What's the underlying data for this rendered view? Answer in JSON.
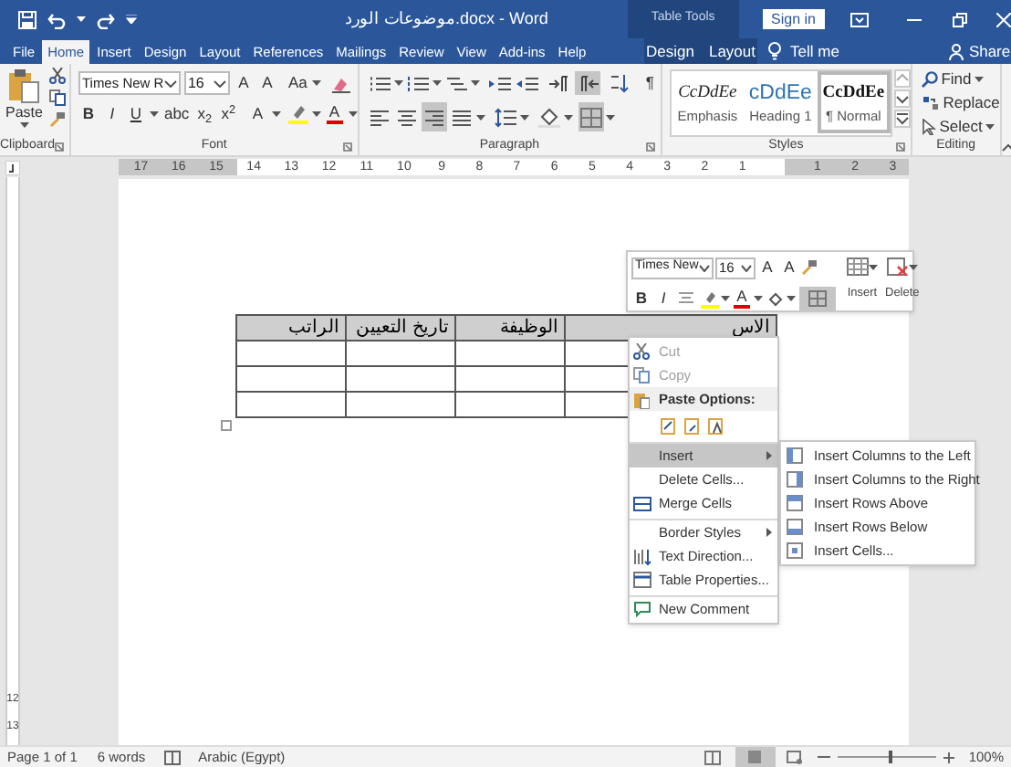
{
  "window": {
    "title": "موضوعات الورد.docx - Word"
  },
  "title_bar": {
    "contextual_label": "Table Tools",
    "sign_in": "Sign in"
  },
  "tabs": [
    {
      "label": "File",
      "selected": false
    },
    {
      "label": "Home",
      "selected": true
    },
    {
      "label": "Insert",
      "selected": false
    },
    {
      "label": "Design",
      "selected": false
    },
    {
      "label": "Layout",
      "selected": false
    },
    {
      "label": "References",
      "selected": false
    },
    {
      "label": "Mailings",
      "selected": false
    },
    {
      "label": "Review",
      "selected": false
    },
    {
      "label": "View",
      "selected": false
    },
    {
      "label": "Add-ins",
      "selected": false
    },
    {
      "label": "Help",
      "selected": false
    }
  ],
  "contextual_tabs": [
    {
      "label": "Design",
      "selected": false
    },
    {
      "label": "Layout",
      "selected": false
    }
  ],
  "tell_me": "Tell me",
  "share": "Share",
  "ribbon": {
    "clipboard": {
      "label": "Clipboard",
      "paste": "Paste"
    },
    "font": {
      "label": "Font",
      "font_name": "Times New R",
      "font_size": "16",
      "grow": "A",
      "shrink": "A",
      "change_case": "Aa",
      "format_buttons": [
        "B",
        "I",
        "U",
        "abc",
        "x$_{2}$",
        "x$^{2}$"
      ],
      "text_effects": "A",
      "font_color": "A"
    },
    "paragraph": {
      "label": "Paragraph",
      "right_to_left_on": true,
      "align_buttons": [
        {
          "selected": false
        },
        {
          "selected": false
        },
        {
          "selected": true
        },
        {
          "selected": false
        }
      ],
      "borders_on": true,
      "show_marks": "¶"
    },
    "styles": {
      "label": "Styles",
      "items": [
        {
          "preview": "CcDdEe",
          "name": "Emphasis",
          "selected": false
        },
        {
          "preview": "cDdEe",
          "name": "Heading 1",
          "selected": false
        },
        {
          "preview": "CcDdEe",
          "name": "¶ Normal",
          "selected": true
        }
      ]
    },
    "editing": {
      "label": "Editing",
      "items": [
        "Find",
        "Replace",
        "Select"
      ]
    }
  },
  "ruler": {
    "left_labels": [
      "17",
      "16",
      "15",
      "14",
      "13",
      "12",
      "11",
      "10",
      "9",
      "8",
      "7",
      "6",
      "5",
      "4",
      "3",
      "2",
      "1"
    ],
    "right_labels": [
      "1",
      "2",
      "3"
    ]
  },
  "vertical_ruler": {
    "labels": [
      "12",
      "13"
    ]
  },
  "table": {
    "header_selected": true,
    "columns": [
      "الاس",
      "الوظيفة",
      "تاريخ التعيين",
      "الراتب"
    ]
  },
  "mini_toolbar": {
    "font_name": "Times New",
    "font_size": "16",
    "grow": "A",
    "shrink": "A",
    "bold": "B",
    "italic": "I",
    "font_color": "A",
    "borders_on": true,
    "insert": "Insert",
    "delete": "Delete"
  },
  "context_menu": {
    "items": [
      {
        "kind": "item",
        "label": "Cut",
        "disabled": true,
        "highlighted": false,
        "submenu": false,
        "separator_before": false
      },
      {
        "kind": "item",
        "label": "Copy",
        "disabled": true,
        "highlighted": false,
        "submenu": false,
        "separator_before": false
      },
      {
        "kind": "header",
        "label": "Paste Options:"
      },
      {
        "kind": "paste_options"
      },
      {
        "kind": "item",
        "label": "Insert",
        "disabled": false,
        "highlighted": true,
        "submenu": true,
        "separator_before": true
      },
      {
        "kind": "item",
        "label": "Delete Cells...",
        "disabled": false,
        "highlighted": false,
        "submenu": false,
        "separator_before": false
      },
      {
        "kind": "item",
        "label": "Merge Cells",
        "disabled": false,
        "highlighted": false,
        "submenu": false,
        "separator_before": false
      },
      {
        "kind": "item",
        "label": "Border Styles",
        "disabled": false,
        "highlighted": false,
        "submenu": true,
        "separator_before": true
      },
      {
        "kind": "item",
        "label": "Text Direction...",
        "disabled": false,
        "highlighted": false,
        "submenu": false,
        "separator_before": false
      },
      {
        "kind": "item",
        "label": "Table Properties...",
        "disabled": false,
        "highlighted": false,
        "submenu": false,
        "separator_before": false
      },
      {
        "kind": "item",
        "label": "New Comment",
        "disabled": false,
        "highlighted": false,
        "submenu": false,
        "separator_before": true
      }
    ]
  },
  "submenu": {
    "items": [
      "Insert Columns to the Left",
      "Insert Columns to the Right",
      "Insert Rows Above",
      "Insert Rows Below",
      "Insert Cells..."
    ]
  },
  "status_bar": {
    "page": "Page 1 of 1",
    "words": "6 words",
    "language": "Arabic (Egypt)",
    "zoom": "100%",
    "zoom_slider": {
      "level": 0.55
    }
  }
}
